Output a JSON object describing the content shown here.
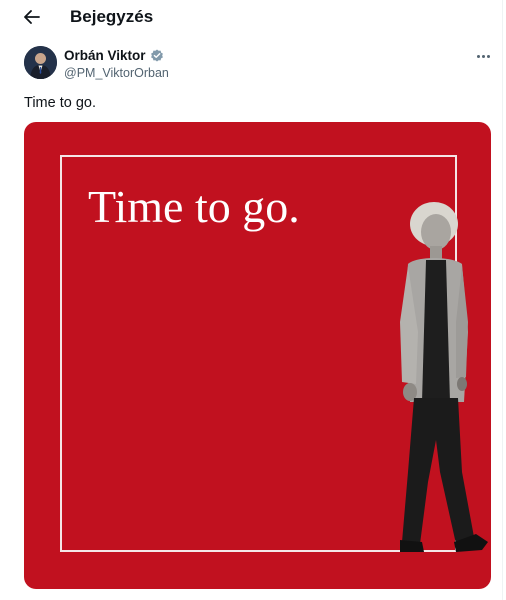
{
  "header": {
    "title": "Bejegyzés",
    "back_icon": "arrow-left-icon"
  },
  "post": {
    "author_name": "Orbán Viktor",
    "handle": "@PM_ViktorOrban",
    "verified_icon": "verified-badge-icon",
    "more_icon": "more-horizontal-icon",
    "text": "Time to go.",
    "media": {
      "headline": "Time to go.",
      "background_color": "#c1111f"
    }
  }
}
